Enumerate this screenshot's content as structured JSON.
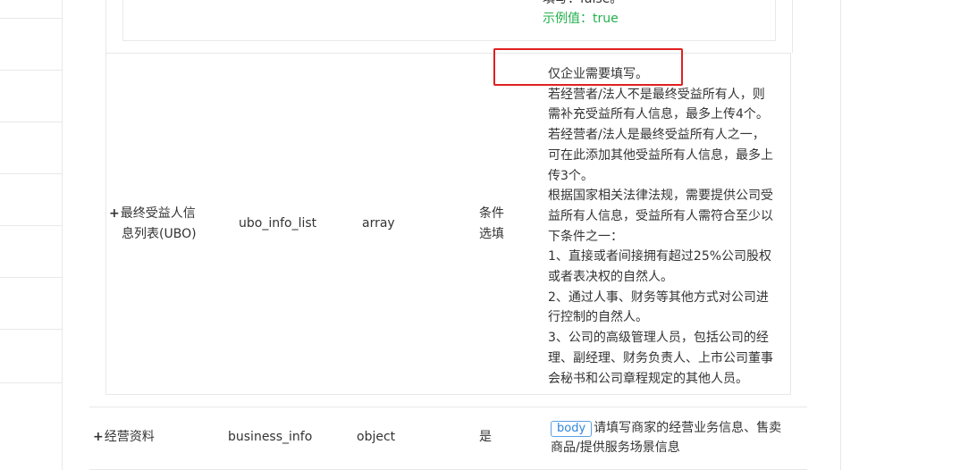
{
  "prev_row": {
    "line1": "填写：false。",
    "example": "示例值：true"
  },
  "ubo_row": {
    "name_line1": "最终受益人信",
    "name_line2": "息列表(UBO)",
    "field": "ubo_info_list",
    "type": "array",
    "required_line1": "条件",
    "required_line2": "选填",
    "desc_lines": [
      "仅企业需要填写。",
      "若经营者/法人不是最终受益所有人，则",
      "需补充受益所有人信息，最多上传4个。",
      "若经营者/法人是最终受益所有人之一，",
      "可在此添加其他受益所有人信息，最多上",
      "传3个。",
      "根据国家相关法律法规，需要提供公司受",
      "益所有人信息，受益所有人需符合至少以",
      "下条件之一：",
      "1、直接或者间接拥有超过25%公司股权",
      "或者表决权的自然人。",
      "2、通过人事、财务等其他方式对公司进",
      "行控制的自然人。",
      "3、公司的高级管理人员，包括公司的经",
      "理、副经理、财务负责人、上市公司董事",
      "会秘书和公司章程规定的其他人员。"
    ]
  },
  "business_row": {
    "name": "经营资料",
    "field": "business_info",
    "type": "object",
    "required": "是",
    "badge": "body",
    "desc_line1": "请填写商家的经营业务信息、售卖",
    "desc_line2": "商品/提供服务场景信息"
  },
  "plus_symbol": "+",
  "colors": {
    "example_green": "#22b14c",
    "badge_blue": "#2e86de",
    "highlight_red": "#e02020"
  }
}
